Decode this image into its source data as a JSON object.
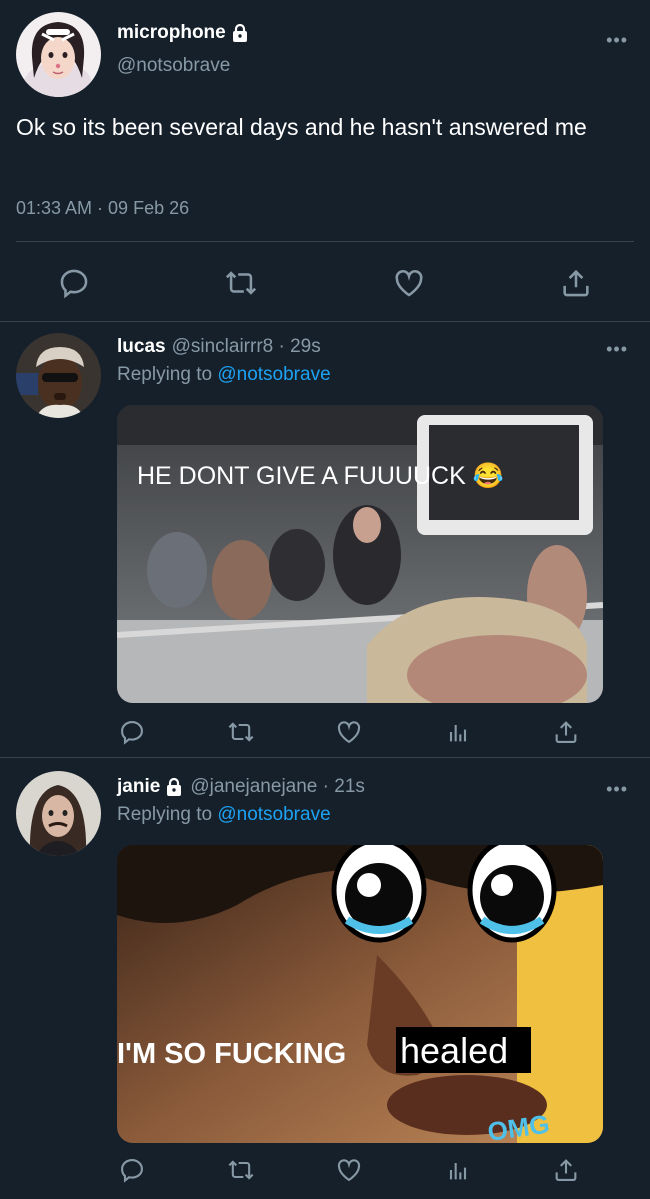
{
  "main_tweet": {
    "display_name": "microphone",
    "handle": "@notsobrave",
    "text": "Ok so its been several days and he hasn't answered me",
    "timestamp": "01:33 AM · 09 Feb 26",
    "more_label": "•••"
  },
  "replies": [
    {
      "display_name": "lucas",
      "handle_time": "@sinclairrr8 · 29s",
      "replying_prefix": "Replying to",
      "replying_to": "@notsobrave",
      "more_label": "•••",
      "media_caption": "HE DONT GIVE A FUUUUCK 😂"
    },
    {
      "display_name": "janie",
      "handle_time": "@janejanejane · 21s",
      "replying_prefix": "Replying to",
      "replying_to": "@notsobrave",
      "more_label": "•••",
      "media_caption_main": "I'M SO FUCKING",
      "media_caption_box": "healed",
      "media_corner": "OMG"
    }
  ],
  "icons": [
    "reply-icon",
    "retweet-icon",
    "like-icon",
    "analytics-icon",
    "share-icon",
    "lock-icon",
    "more-icon"
  ],
  "colors": {
    "background": "#15202b",
    "divider": "#38444d",
    "muted_text": "#8899a6",
    "link": "#1da1f2"
  }
}
